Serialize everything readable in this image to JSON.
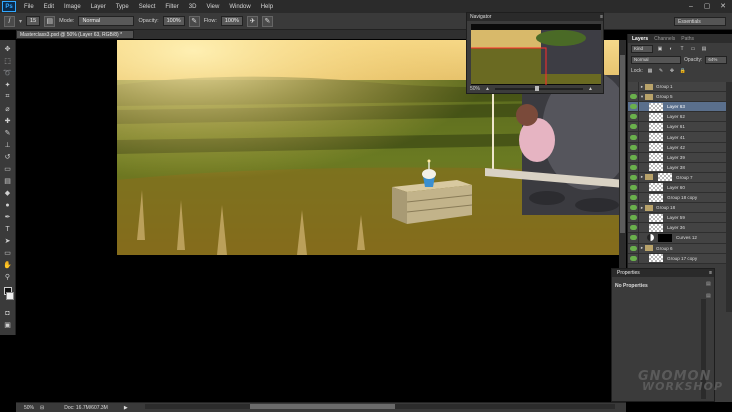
{
  "menubar": {
    "logo": "Ps",
    "items": [
      "File",
      "Edit",
      "Image",
      "Layer",
      "Type",
      "Select",
      "Filter",
      "3D",
      "View",
      "Window",
      "Help"
    ]
  },
  "options": {
    "size": "15",
    "mode_label": "Mode:",
    "mode_value": "Normal",
    "opacity_label": "Opacity:",
    "opacity_value": "100%",
    "flow_label": "Flow:",
    "flow_value": "100%",
    "workspace": "Essentials"
  },
  "document": {
    "tab": "Masterclass3.psd @ 50% (Layer 63, RGB/8) *",
    "zoom": "50%",
    "doc_size": "Doc: 16.7M/607.3M"
  },
  "navigator": {
    "title": "Navigator",
    "zoom": "50%"
  },
  "layers_panel": {
    "tabs": [
      "Layers",
      "Channels",
      "Paths"
    ],
    "kind": "Kind",
    "blend_mode": "Normal",
    "opacity_label": "Opacity:",
    "opacity_value": "64%",
    "lock_label": "Lock:",
    "items": [
      {
        "name": "Group 1",
        "type": "group",
        "visible": false,
        "expanded": false
      },
      {
        "name": "Group 5",
        "type": "group",
        "visible": true,
        "expanded": true
      },
      {
        "name": "Layer 63",
        "type": "layer",
        "visible": true,
        "selected": true
      },
      {
        "name": "Layer 62",
        "type": "layer",
        "visible": true
      },
      {
        "name": "Layer 61",
        "type": "layer",
        "visible": true
      },
      {
        "name": "Layer 41",
        "type": "layer",
        "visible": true
      },
      {
        "name": "Layer 42",
        "type": "layer",
        "visible": true
      },
      {
        "name": "Layer 39",
        "type": "layer",
        "visible": true
      },
      {
        "name": "Layer 38",
        "type": "layer",
        "visible": true
      },
      {
        "name": "Group 7",
        "type": "group",
        "visible": true,
        "expanded": false
      },
      {
        "name": "Layer 60",
        "type": "layer",
        "visible": true
      },
      {
        "name": "Group 18 copy",
        "type": "layer",
        "visible": true
      },
      {
        "name": "Group 18",
        "type": "group",
        "visible": true,
        "expanded": false
      },
      {
        "name": "Layer 59",
        "type": "layer",
        "visible": true
      },
      {
        "name": "Layer 36",
        "type": "layer",
        "visible": true
      },
      {
        "name": "Curves 12",
        "type": "adjustment",
        "visible": true
      },
      {
        "name": "Group 6",
        "type": "group",
        "visible": true,
        "expanded": false
      },
      {
        "name": "Group 17 copy",
        "type": "layer",
        "visible": true
      }
    ]
  },
  "properties_panel": {
    "tab": "Properties",
    "body": "No Properties"
  },
  "watermark": {
    "line1": "GNOMON",
    "line2": "WORKSHOP"
  },
  "colors": {
    "ui_dark": "#3a3a3a",
    "ui_darker": "#2b2b2b",
    "selection": "#5a6f8c",
    "eye_green": "#6ab04c"
  }
}
